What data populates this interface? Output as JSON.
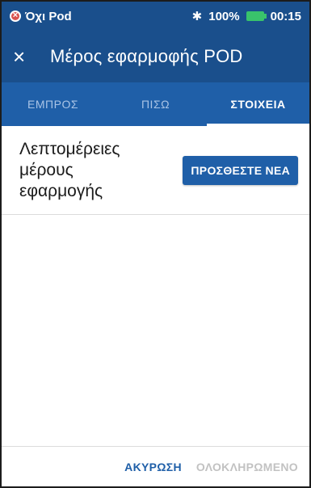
{
  "status_bar": {
    "left_text": "Όχι Pod",
    "battery": "100%",
    "time": "00:15",
    "colors": {
      "background": "#1a4f8c",
      "battery_green": "#39c36b",
      "alert_red": "#d9534f"
    }
  },
  "app_bar": {
    "close_icon": "×",
    "title": "Μέρος εφαρμοφής POD"
  },
  "tabs": [
    {
      "label": "ΕΜΠΡΟΣ",
      "active": false
    },
    {
      "label": "ΠΙΣΩ",
      "active": false
    },
    {
      "label": "ΣΤΟΙΧΕΙΑ",
      "active": true
    }
  ],
  "details": {
    "title": "Λεπτομέρειες μέρους εφαρμογής",
    "add_new_label": "ΠΡΟΣΘΕΣΤΕ ΝΕΑ"
  },
  "footer": {
    "cancel_label": "ΑΚΥΡΩΣΗ",
    "done_label": "ΟΛΟΚΛΗΡΩΜΕΝΟ"
  },
  "icons": {
    "no_pod": "no-pod-alert-icon",
    "bluetooth": "bluetooth-icon",
    "battery": "battery-icon",
    "close": "close-icon"
  }
}
